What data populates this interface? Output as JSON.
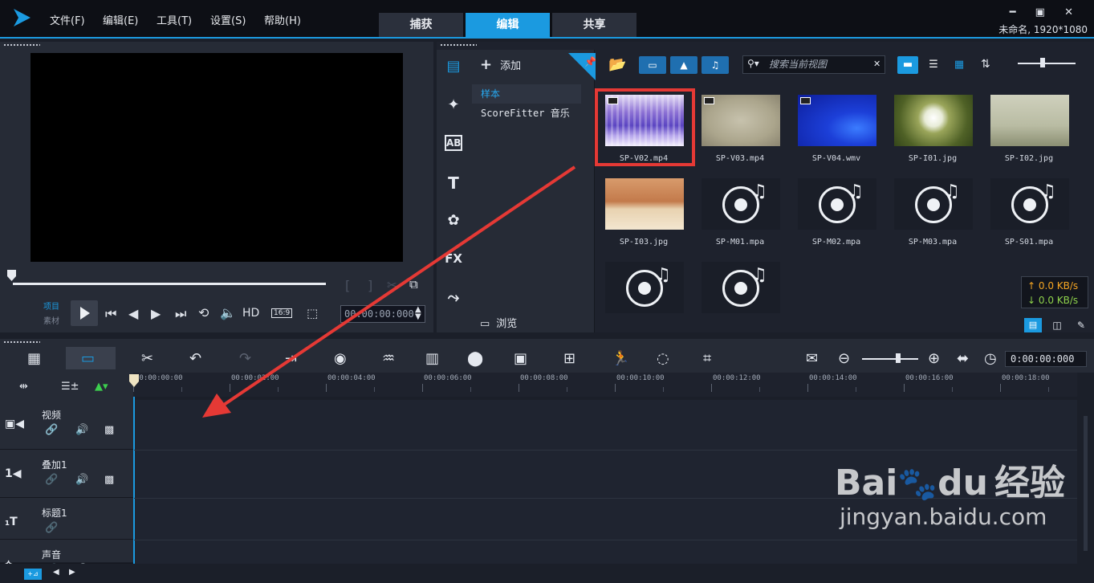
{
  "menu": [
    "文件(F)",
    "编辑(E)",
    "工具(T)",
    "设置(S)",
    "帮助(H)"
  ],
  "tabs": [
    "捕获",
    "编辑",
    "共享"
  ],
  "active_tab": "编辑",
  "window_controls": "━ ▣ ✕",
  "project_info": "未命名, 1920*1080",
  "player": {
    "mode_project": "项目",
    "mode_clip": "素材",
    "hd_label": "HD",
    "aspect": "16:9",
    "timecode": "00:00:00:000"
  },
  "library": {
    "add_label": "添加",
    "folders": [
      "样本",
      "ScoreFitter 音乐"
    ],
    "browse_label": "浏览",
    "search_placeholder": "搜索当前视图",
    "side_icons": [
      "media-icon",
      "instant-project-icon",
      "transition-icon",
      "title-icon",
      "graphics-icon",
      "fx-icon",
      "path-icon"
    ],
    "side_labels": {
      "transition": "AB",
      "title": "T",
      "fx": "FX"
    },
    "items": [
      {
        "name": "SP-V02.mp4",
        "kind": "video",
        "thumb": "mosaic"
      },
      {
        "name": "SP-V03.mp4",
        "kind": "video",
        "thumb": "beige"
      },
      {
        "name": "SP-V04.wmv",
        "kind": "video",
        "thumb": "blue"
      },
      {
        "name": "SP-I01.jpg",
        "kind": "image",
        "thumb": "dandelion"
      },
      {
        "name": "SP-I02.jpg",
        "kind": "image",
        "thumb": "trees"
      },
      {
        "name": "SP-I03.jpg",
        "kind": "image",
        "thumb": "desert"
      },
      {
        "name": "SP-M01.mpa",
        "kind": "audio"
      },
      {
        "name": "SP-M02.mpa",
        "kind": "audio"
      },
      {
        "name": "SP-M03.mpa",
        "kind": "audio"
      },
      {
        "name": "SP-S01.mpa",
        "kind": "audio"
      },
      {
        "name": "",
        "kind": "audio"
      },
      {
        "name": "",
        "kind": "audio"
      }
    ],
    "speed_up": "↑ 0.0 KB/s",
    "speed_down": "↓ 0.0 KB/s"
  },
  "timeline": {
    "time": "0:00:00:000",
    "ticks": [
      "00:00:00:00",
      "00:00:02:00",
      "00:00:04:00",
      "00:00:06:00",
      "00:00:08:00",
      "00:00:10:00",
      "00:00:12:00",
      "00:00:14:00",
      "00:00:16:00",
      "00:00:18:00"
    ],
    "tracks": [
      {
        "name": "视频",
        "icon": "video-track-icon"
      },
      {
        "name": "叠加1",
        "icon": "overlay-track-icon"
      },
      {
        "name": "标题1",
        "icon": "title-track-icon"
      },
      {
        "name": "声音",
        "icon": "voice-track-icon"
      }
    ]
  },
  "watermark": {
    "brand": "Bai",
    "brand2": "du",
    "cn": "经验",
    "url": "jingyan.baidu.com"
  },
  "colors": {
    "accent": "#1b9ae0",
    "highlight": "#e53935",
    "arrow": "#e53935"
  }
}
